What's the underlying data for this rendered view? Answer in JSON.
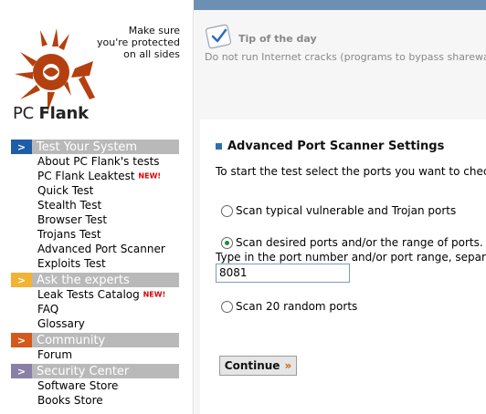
{
  "brand": {
    "name_regular": "PC ",
    "name_bold": "Flank",
    "tagline_line1": "Make sure",
    "tagline_line2": "you're protected",
    "tagline_line3": "on all sides"
  },
  "menu": {
    "sections": [
      {
        "title": "Test Your System",
        "color": "#1e5ea8",
        "items": [
          "About PC Flank's tests",
          "PC Flank Leaktest",
          "Quick Test",
          "Stealth Test",
          "Browser Test",
          "Trojans Test",
          "Advanced Port Scanner",
          "Exploits Test"
        ],
        "new_badge_index": 1
      },
      {
        "title": "Ask the experts",
        "color": "#f2b233",
        "items": [
          "Leak Tests Catalog",
          "FAQ",
          "Glossary"
        ],
        "new_badge_index": 0
      },
      {
        "title": "Community",
        "color": "#d35a1c",
        "items": [
          "Forum"
        ]
      },
      {
        "title": "Security Center",
        "color": "#8a7fa7",
        "items": [
          "Software Store",
          "Books Store"
        ]
      }
    ],
    "new_label": "NEW!"
  },
  "tip": {
    "title": "Tip of the day",
    "text": "Do not run Internet cracks (programs to bypass shareware limita"
  },
  "main": {
    "heading": "Advanced Port Scanner Settings",
    "intro": "To start the test select the ports you want to check and",
    "option1": "Scan typical vulnerable and Trojan ports",
    "option2": "Scan desired ports and/or the range of ports.",
    "hint": "Type in the port number and/or port range, separated b",
    "port_value": "8081",
    "option3": "Scan 20 random ports",
    "selected_option": 2,
    "continue_label": "Continue",
    "continue_arrow": "»"
  },
  "colors": {
    "topbar": "#6d8fb3",
    "heading_square": "#2d6fb5",
    "radio_selected": "#1a8f3c",
    "new_badge": "#dd0000",
    "logo": "#b5400f"
  }
}
